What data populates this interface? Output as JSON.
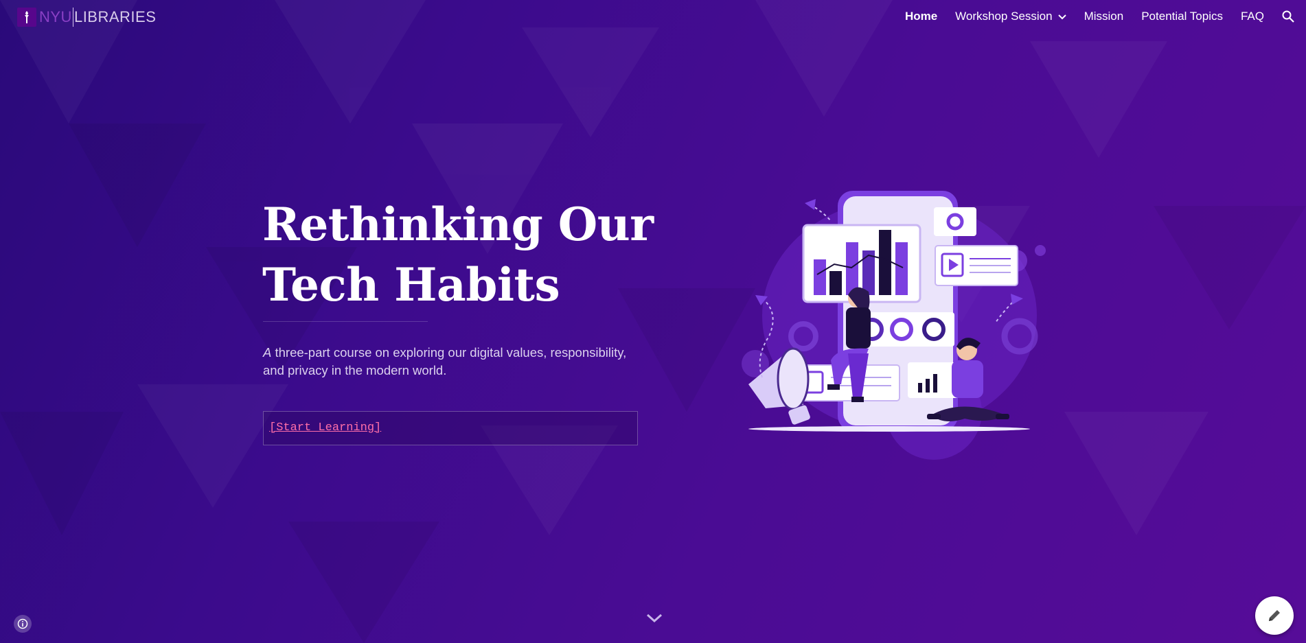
{
  "header": {
    "logo_nyu": "NYU",
    "logo_libraries": "LIBRARIES",
    "nav": [
      {
        "label": "Home",
        "active": true
      },
      {
        "label": "Workshop Session",
        "has_dropdown": true
      },
      {
        "label": "Mission"
      },
      {
        "label": "Potential Topics"
      },
      {
        "label": "FAQ"
      }
    ]
  },
  "hero": {
    "title_line1": "Rethinking Our",
    "title_line2": "Tech Habits",
    "subtitle_em": "A",
    "subtitle_rest": " three-part course on exploring our digital values, responsibility, and privacy in the modern world.",
    "cta_label": "[Start Learning]"
  },
  "icons": [
    "torch-icon",
    "chevron-down-icon",
    "search-icon",
    "info-icon",
    "pencil-icon",
    "scroll-down-chevron-icon"
  ],
  "colors": {
    "background": "#3b0b8c",
    "accent_link": "#ff6fa8",
    "nyu_purple": "#57068c"
  }
}
